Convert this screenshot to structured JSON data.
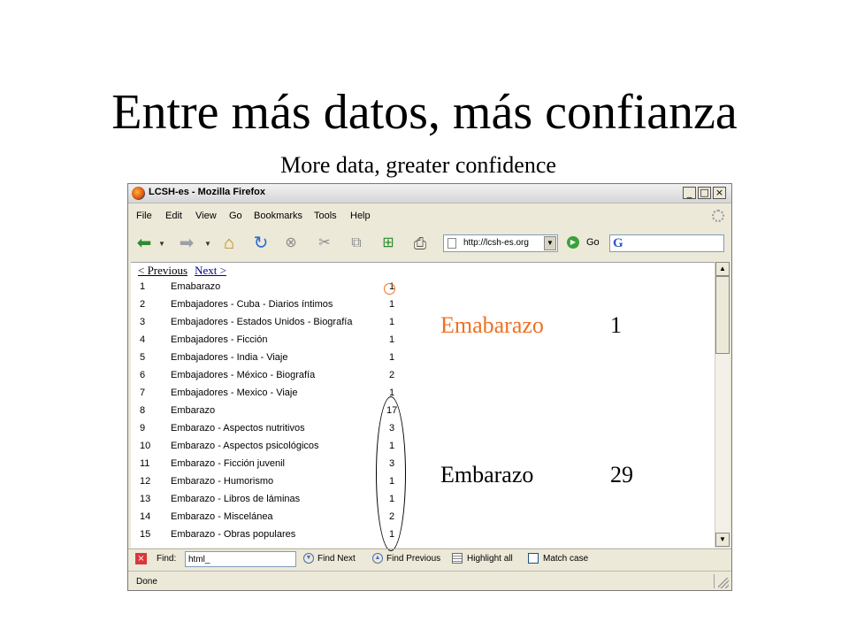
{
  "slide": {
    "title": "Entre más datos, más confianza",
    "subtitle": "More data, greater confidence"
  },
  "window": {
    "title": "LCSH-es - Mozilla Firefox",
    "controls": [
      "_",
      "□",
      "×"
    ]
  },
  "menu": [
    "File",
    "Edit",
    "View",
    "Go",
    "Bookmarks",
    "Tools",
    "Help"
  ],
  "toolbar": {
    "url": "http://lcsh-es.org",
    "go_label": "Go",
    "search_engine_icon": "G"
  },
  "pager": {
    "previous": "< Previous",
    "next": "Next >"
  },
  "rows": [
    {
      "n": "1",
      "heading": "Emabarazo",
      "count": "1"
    },
    {
      "n": "2",
      "heading": "Embajadores - Cuba - Diarios íntimos",
      "count": "1"
    },
    {
      "n": "3",
      "heading": "Embajadores - Estados Unidos - Biografía",
      "count": "1"
    },
    {
      "n": "4",
      "heading": "Embajadores - Ficción",
      "count": "1"
    },
    {
      "n": "5",
      "heading": "Embajadores - India - Viaje",
      "count": "1"
    },
    {
      "n": "6",
      "heading": "Embajadores - México - Biografía",
      "count": "2"
    },
    {
      "n": "7",
      "heading": "Embajadores - Mexico - Viaje",
      "count": "1"
    },
    {
      "n": "8",
      "heading": "Embarazo",
      "count": "17"
    },
    {
      "n": "9",
      "heading": "Embarazo - Aspectos nutritivos",
      "count": "3"
    },
    {
      "n": "10",
      "heading": "Embarazo - Aspectos psicológicos",
      "count": "1"
    },
    {
      "n": "11",
      "heading": "Embarazo - Ficción juvenil",
      "count": "3"
    },
    {
      "n": "12",
      "heading": "Embarazo - Humorismo",
      "count": "1"
    },
    {
      "n": "13",
      "heading": "Embarazo - Libros de láminas",
      "count": "1"
    },
    {
      "n": "14",
      "heading": "Embarazo - Miscelánea",
      "count": "2"
    },
    {
      "n": "15",
      "heading": "Embarazo - Obras populares",
      "count": "1"
    }
  ],
  "callouts": {
    "misspelled": {
      "term": "Emabarazo",
      "count": "1",
      "color": "#f07020"
    },
    "correct": {
      "term": "Embarazo",
      "count": "29",
      "color": "#000000"
    }
  },
  "findbar": {
    "label": "Find:",
    "value": "html_",
    "next": "Find Next",
    "previous": "Find Previous",
    "highlight": "Highlight all",
    "match_case": "Match case"
  },
  "status": "Done"
}
